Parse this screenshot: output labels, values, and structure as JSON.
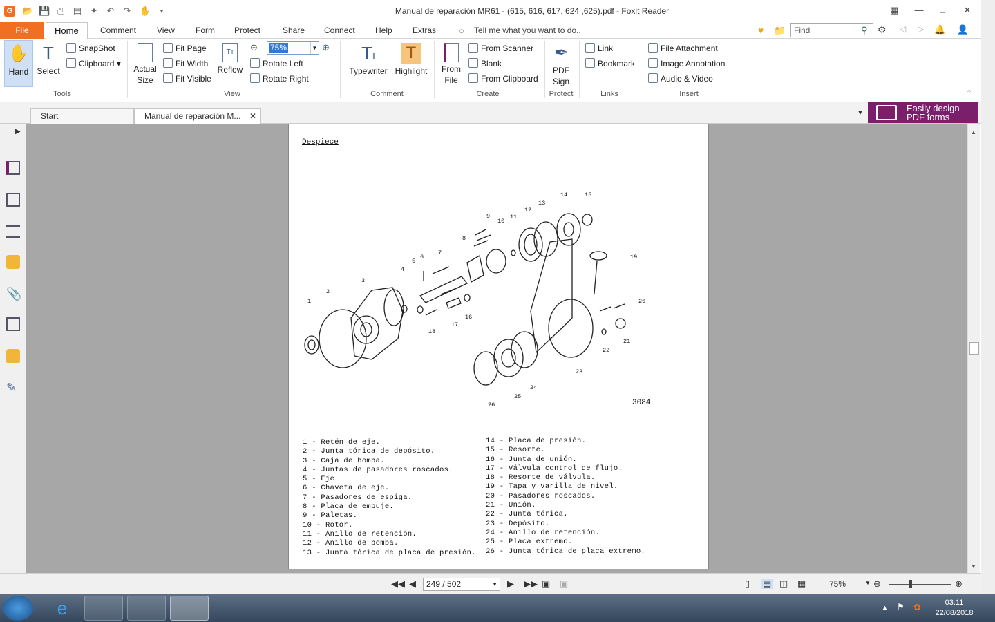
{
  "window": {
    "title": "Manual de reparación MR61 - (615, 616, 617, 624 ,625).pdf - Foxit Reader"
  },
  "menu": {
    "file": "File",
    "tabs": [
      "Home",
      "Comment",
      "View",
      "Form",
      "Protect",
      "Share",
      "Connect",
      "Help",
      "Extras"
    ],
    "tell_me": "Tell me what you want to do..",
    "find_placeholder": "Find"
  },
  "ribbon": {
    "tools": {
      "hand": "Hand",
      "select": "Select",
      "snapshot": "SnapShot",
      "clipboard": "Clipboard",
      "group": "Tools"
    },
    "view": {
      "actual_size": "Actual\nSize",
      "fit_page": "Fit Page",
      "fit_width": "Fit Width",
      "fit_visible": "Fit Visible",
      "reflow": "Reflow",
      "zoom": "75%",
      "rotate_left": "Rotate Left",
      "rotate_right": "Rotate Right",
      "group": "View"
    },
    "comment": {
      "typewriter": "Typewriter",
      "highlight": "Highlight",
      "group": "Comment"
    },
    "create": {
      "from_file": "From\nFile",
      "from_scanner": "From Scanner",
      "blank": "Blank",
      "from_clipboard": "From Clipboard",
      "group": "Create"
    },
    "protect": {
      "pdf_sign": "PDF\nSign",
      "group": "Protect"
    },
    "links": {
      "link": "Link",
      "bookmark": "Bookmark",
      "group": "Links"
    },
    "insert": {
      "file_attachment": "File Attachment",
      "image_annotation": "Image Annotation",
      "audio_video": "Audio & Video",
      "group": "Insert"
    }
  },
  "doc_tabs": {
    "start": "Start",
    "document": "Manual de reparación M...",
    "promo_line1": "Easily design",
    "promo_line2": "PDF forms"
  },
  "page_content": {
    "heading": "Despiece",
    "figure_number": "3084",
    "diagram_labels": [
      "1",
      "2",
      "3",
      "4",
      "5",
      "6",
      "7",
      "8",
      "9",
      "10",
      "11",
      "12",
      "13",
      "14",
      "15",
      "16",
      "17",
      "18",
      "19",
      "20",
      "21",
      "22",
      "23",
      "24",
      "25",
      "26"
    ],
    "legend_left": [
      "1 - Retén de eje.",
      "2 - Junta tórica de depósito.",
      "3 - Caja de bomba.",
      "4 - Juntas de pasadores roscados.",
      "5 - Eje",
      "6 - Chaveta de eje.",
      "7 - Pasadores de espiga.",
      "8 - Placa de empuje.",
      "9 - Paletas.",
      "10 - Rotor.",
      "11 - Anillo de retención.",
      "12 - Anillo de bomba.",
      "13 - Junta tórica de placa de presión."
    ],
    "legend_right": [
      "14 - Placa de presión.",
      "15 - Resorte.",
      "16 - Junta de unión.",
      "17 - Válvula control de flujo.",
      "18 - Resorte de válvula.",
      "19 - Tapa y varilla de nivel.",
      "20 - Pasadores roscados.",
      "21 - Unión.",
      "22 - Junta tórica.",
      "23 - Depósito.",
      "24 - Anillo de retención.",
      "25 - Placa extremo.",
      "26 - Junta tórica de placa extremo."
    ]
  },
  "status": {
    "page": "249 / 502",
    "zoom": "75%"
  },
  "taskbar": {
    "time": "03:11",
    "date": "22/08/2018"
  }
}
